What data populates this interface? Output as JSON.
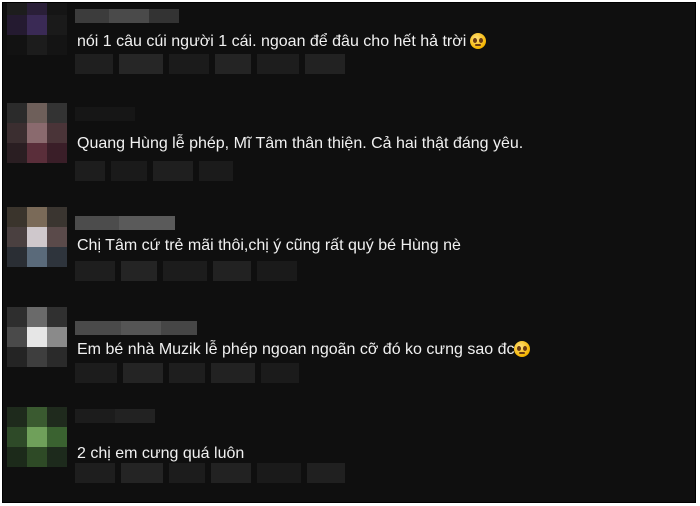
{
  "comments": [
    {
      "text": "nói 1 câu cúi người 1 cái. ngoan để đâu cho hết hả trời",
      "emoji": "pleading-face-icon"
    },
    {
      "text": "Quang Hùng lễ phép, Mĩ Tâm thân thiện. Cả hai thật đáng yêu.",
      "emoji": ""
    },
    {
      "text": "Chị Tâm cứ trẻ mãi thôi,chị ý cũng rất quý bé Hùng nè",
      "emoji": ""
    },
    {
      "text": "Em bé nhà Muzik lễ phép ngoan ngoãn cỡ đó ko cưng sao đc",
      "emoji": "pleading-face-icon"
    },
    {
      "text": "2 chị em cưng quá luôn",
      "emoji": ""
    }
  ],
  "colors": {
    "background": "#0f0f0f",
    "text": "#f1f1f1",
    "emoji": "#f4b400",
    "frame_border": "#000000"
  }
}
